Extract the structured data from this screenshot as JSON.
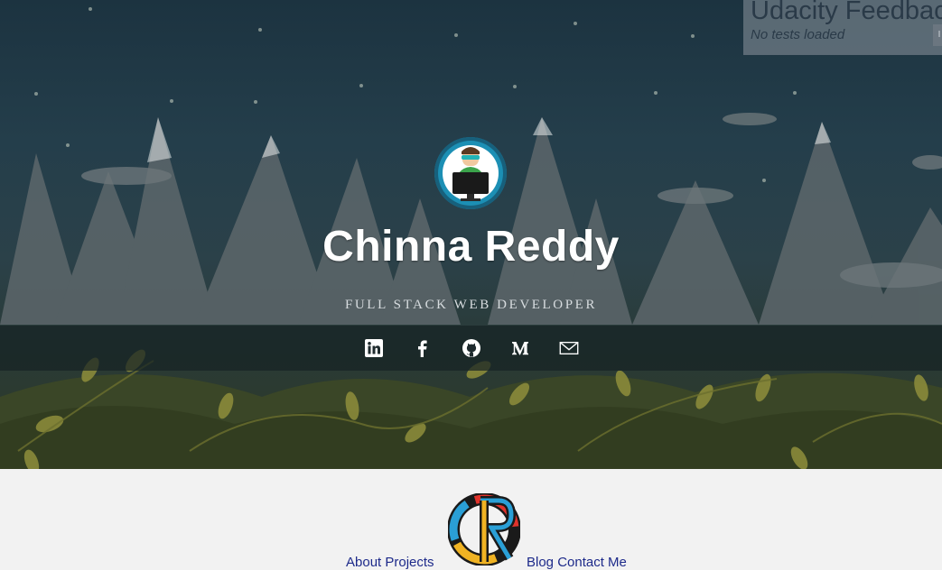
{
  "profile": {
    "name": "Chinna Reddy",
    "tagline": "FULL STACK WEB DEVELOPER"
  },
  "social": [
    {
      "name": "linkedin-icon",
      "glyph": "in"
    },
    {
      "name": "facebook-icon",
      "glyph": "f"
    },
    {
      "name": "github-icon",
      "glyph": "octocat"
    },
    {
      "name": "medium-icon",
      "glyph": "M"
    },
    {
      "name": "mail-icon",
      "glyph": "envelope"
    }
  ],
  "feedback": {
    "title": "Udacity Feedback",
    "status": "No tests loaded"
  },
  "nav": {
    "left": "About Projects",
    "right": "Blog Contact Me"
  },
  "colors": {
    "accent": "#1c8fb4",
    "nav_link": "#1d2a8a",
    "footer_bg": "#f2f2f2"
  }
}
